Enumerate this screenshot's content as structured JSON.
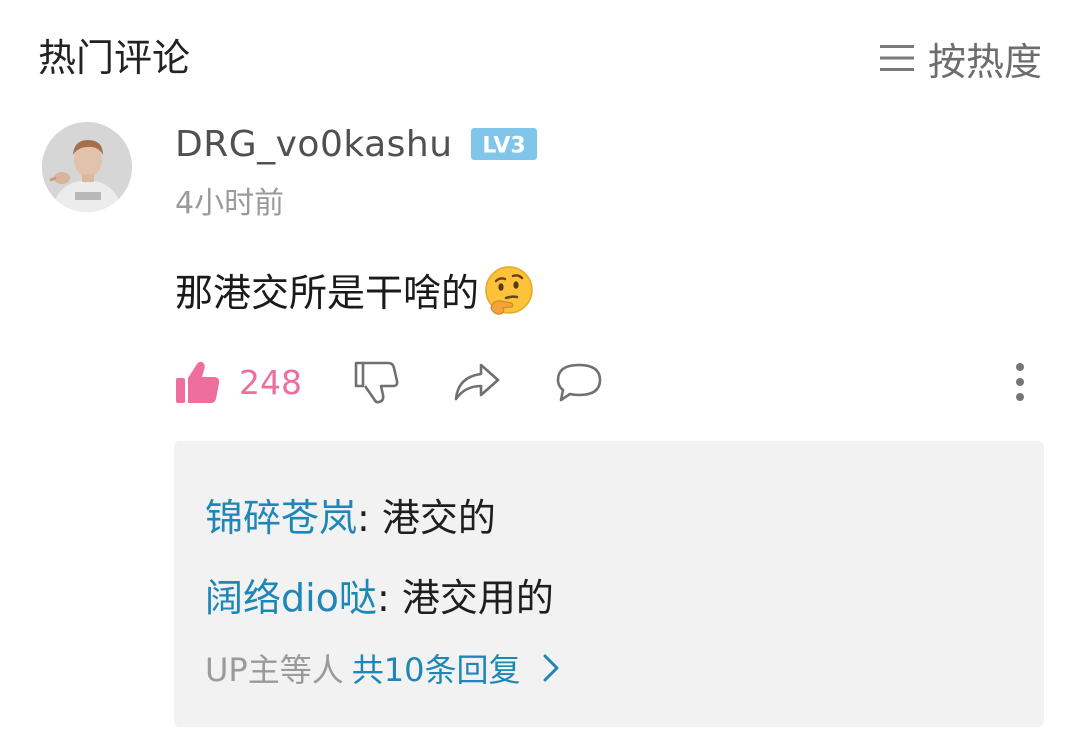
{
  "header": {
    "title": "热门评论",
    "sort_label": "按热度"
  },
  "comment": {
    "username": "DRG_vo0kashu",
    "level": "LV3",
    "time": "4小时前",
    "text": "那港交所是干啥的",
    "emoji": "thinking-face",
    "like_count": "248"
  },
  "replies": [
    {
      "name": "锦碎苍岚",
      "separator": ": ",
      "text": "港交的"
    },
    {
      "name": "阔络dio哒",
      "separator": ": ",
      "text": "港交用的"
    }
  ],
  "more_replies": {
    "prefix": "UP主等人",
    "count_label": "共10条回复"
  },
  "colors": {
    "accent_pink": "#ee6f9c",
    "link_blue": "#1e87b7",
    "level_badge": "#7fc6ea",
    "reply_bg": "#f2f2f2"
  },
  "icons": {
    "sort": "menu-icon",
    "like": "thumbs-up-icon",
    "dislike": "thumbs-down-icon",
    "share": "share-arrow-icon",
    "comment": "speech-bubble-icon",
    "more": "vertical-dots-icon",
    "expand": "chevron-right-icon"
  }
}
